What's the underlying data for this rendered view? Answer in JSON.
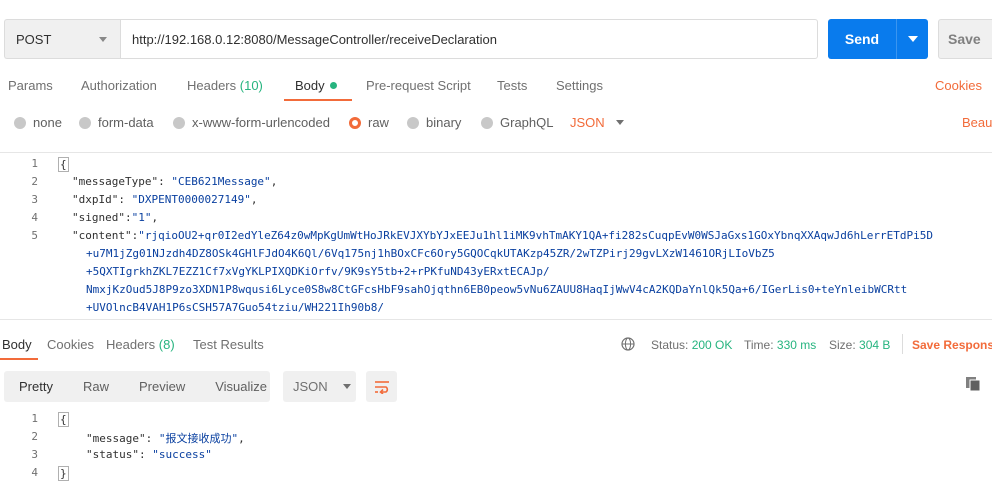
{
  "request": {
    "method": "POST",
    "url": "http://192.168.0.12:8080/MessageController/receiveDeclaration",
    "send_label": "Send",
    "save_label": "Save"
  },
  "request_tabs": [
    {
      "label": "Params"
    },
    {
      "label": "Authorization"
    },
    {
      "label": "Headers",
      "count": "(10)"
    },
    {
      "label": "Body",
      "active": true
    },
    {
      "label": "Pre-request Script"
    },
    {
      "label": "Tests"
    },
    {
      "label": "Settings"
    }
  ],
  "cookies_link": "Cookies",
  "body_types": [
    {
      "label": "none"
    },
    {
      "label": "form-data"
    },
    {
      "label": "x-www-form-urlencoded"
    },
    {
      "label": "raw",
      "selected": true
    },
    {
      "label": "binary"
    },
    {
      "label": "GraphQL"
    }
  ],
  "raw_format": "JSON",
  "beautify_label": "Beau",
  "request_body": {
    "line_numbers": [
      "1",
      "2",
      "3",
      "4",
      "5"
    ],
    "open_brace": "{",
    "messageType_key": "\"messageType\"",
    "messageType_val": "\"CEB621Message\"",
    "dxpId_key": "\"dxpId\"",
    "dxpId_val": "\"DXPENT0000027149\"",
    "signed_key": "\"signed\"",
    "signed_val": "\"1\"",
    "content_key": "\"content\"",
    "content_lines": [
      "\"rjqioOU2+qr0I2edYleZ64z0wMpKgUmWtHoJRkEVJXYbYJxEEJu1hl1iMK9vhTmAKY1QA+fi282sCuqpEvW0WSJaGxs1GOxYbnqXXAqwJd6hLerrETdPi5D",
      "+u7M1jZg01NJzdh4DZ8OSk4GHlFJdO4K6Ql/6Vq175nj1hBOxCFc6Ory5GQOCqkUTAKzp45ZR/2wTZPirj29gvLXzW1461ORjLIoVbZ5",
      "+5QXTIgrkhZKL7EZZ1Cf7xVgYKLPIXQDKiOrfv/9K9sY5tb+2+rPKfuND43yERxtECAJp/",
      "NmxjKzOud5J8P9zo3XDN1P8wqusi6Lyce0S8w8CtGFcsHbF9sahOjqthn6EB0peow5vNu6ZAUU8HaqIjWwV4cA2KQDaYnlQk5Qa+6/IGerLis0+teYnleibWCRtt",
      "+UVOlncB4VAH1P6sCSH57A7Guo54tziu/WH221Ih90b8/"
    ]
  },
  "response_tabs": [
    {
      "label": "Body",
      "active": true
    },
    {
      "label": "Cookies"
    },
    {
      "label": "Headers",
      "count": "(8)"
    },
    {
      "label": "Test Results"
    }
  ],
  "response_status": {
    "status_label": "Status:",
    "status_value": "200 OK",
    "time_label": "Time:",
    "time_value": "330 ms",
    "size_label": "Size:",
    "size_value": "304 B",
    "save_response": "Save Respons"
  },
  "view_modes": [
    {
      "label": "Pretty",
      "active": true
    },
    {
      "label": "Raw"
    },
    {
      "label": "Preview"
    },
    {
      "label": "Visualize"
    }
  ],
  "response_format": "JSON",
  "response_body": {
    "line_numbers": [
      "1",
      "2",
      "3",
      "4"
    ],
    "open_brace": "{",
    "message_key": "\"message\"",
    "message_val": "\"报文接收成功\"",
    "status_key": "\"status\"",
    "status_val": "\"success\"",
    "close_brace": "}"
  },
  "icons": {
    "method_dropdown": "chevron-down-icon",
    "send_dropdown": "chevron-down-icon",
    "globe": "globe-icon",
    "wrap": "wrap-lines-icon",
    "copy": "copy-icon"
  },
  "colors": {
    "accent": "#f26b3a",
    "send": "#097bed",
    "success": "#26b47f",
    "string": "#0a40a0"
  }
}
